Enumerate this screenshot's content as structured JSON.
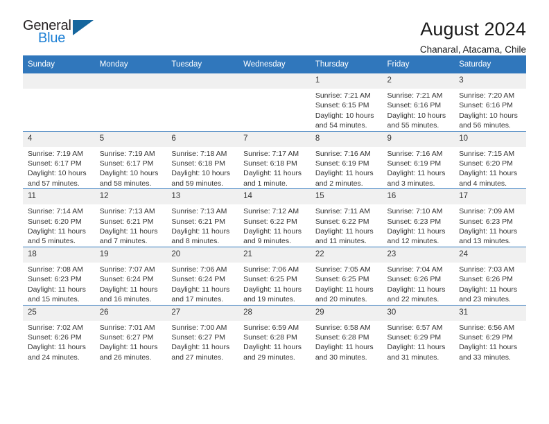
{
  "brand": {
    "name_top": "General",
    "name_bottom": "Blue",
    "triangle_color": "#15669e",
    "blue_color": "#1c7fd4"
  },
  "header": {
    "title": "August 2024",
    "subtitle": "Chanaral, Atacama, Chile"
  },
  "theme": {
    "header_bar": "#3077bc",
    "day_strip": "#f0f0f0",
    "text": "#333333"
  },
  "weekday_headers": [
    "Sunday",
    "Monday",
    "Tuesday",
    "Wednesday",
    "Thursday",
    "Friday",
    "Saturday"
  ],
  "labels": {
    "sunrise": "Sunrise:",
    "sunset": "Sunset:",
    "daylight": "Daylight:"
  },
  "weeks": [
    [
      {
        "day": "",
        "blank": true
      },
      {
        "day": "",
        "blank": true
      },
      {
        "day": "",
        "blank": true
      },
      {
        "day": "",
        "blank": true
      },
      {
        "day": "1",
        "sunrise": "Sunrise: 7:21 AM",
        "sunset": "Sunset: 6:15 PM",
        "daylight": "Daylight: 10 hours and 54 minutes."
      },
      {
        "day": "2",
        "sunrise": "Sunrise: 7:21 AM",
        "sunset": "Sunset: 6:16 PM",
        "daylight": "Daylight: 10 hours and 55 minutes."
      },
      {
        "day": "3",
        "sunrise": "Sunrise: 7:20 AM",
        "sunset": "Sunset: 6:16 PM",
        "daylight": "Daylight: 10 hours and 56 minutes."
      }
    ],
    [
      {
        "day": "4",
        "sunrise": "Sunrise: 7:19 AM",
        "sunset": "Sunset: 6:17 PM",
        "daylight": "Daylight: 10 hours and 57 minutes."
      },
      {
        "day": "5",
        "sunrise": "Sunrise: 7:19 AM",
        "sunset": "Sunset: 6:17 PM",
        "daylight": "Daylight: 10 hours and 58 minutes."
      },
      {
        "day": "6",
        "sunrise": "Sunrise: 7:18 AM",
        "sunset": "Sunset: 6:18 PM",
        "daylight": "Daylight: 10 hours and 59 minutes."
      },
      {
        "day": "7",
        "sunrise": "Sunrise: 7:17 AM",
        "sunset": "Sunset: 6:18 PM",
        "daylight": "Daylight: 11 hours and 1 minute."
      },
      {
        "day": "8",
        "sunrise": "Sunrise: 7:16 AM",
        "sunset": "Sunset: 6:19 PM",
        "daylight": "Daylight: 11 hours and 2 minutes."
      },
      {
        "day": "9",
        "sunrise": "Sunrise: 7:16 AM",
        "sunset": "Sunset: 6:19 PM",
        "daylight": "Daylight: 11 hours and 3 minutes."
      },
      {
        "day": "10",
        "sunrise": "Sunrise: 7:15 AM",
        "sunset": "Sunset: 6:20 PM",
        "daylight": "Daylight: 11 hours and 4 minutes."
      }
    ],
    [
      {
        "day": "11",
        "sunrise": "Sunrise: 7:14 AM",
        "sunset": "Sunset: 6:20 PM",
        "daylight": "Daylight: 11 hours and 5 minutes."
      },
      {
        "day": "12",
        "sunrise": "Sunrise: 7:13 AM",
        "sunset": "Sunset: 6:21 PM",
        "daylight": "Daylight: 11 hours and 7 minutes."
      },
      {
        "day": "13",
        "sunrise": "Sunrise: 7:13 AM",
        "sunset": "Sunset: 6:21 PM",
        "daylight": "Daylight: 11 hours and 8 minutes."
      },
      {
        "day": "14",
        "sunrise": "Sunrise: 7:12 AM",
        "sunset": "Sunset: 6:22 PM",
        "daylight": "Daylight: 11 hours and 9 minutes."
      },
      {
        "day": "15",
        "sunrise": "Sunrise: 7:11 AM",
        "sunset": "Sunset: 6:22 PM",
        "daylight": "Daylight: 11 hours and 11 minutes."
      },
      {
        "day": "16",
        "sunrise": "Sunrise: 7:10 AM",
        "sunset": "Sunset: 6:23 PM",
        "daylight": "Daylight: 11 hours and 12 minutes."
      },
      {
        "day": "17",
        "sunrise": "Sunrise: 7:09 AM",
        "sunset": "Sunset: 6:23 PM",
        "daylight": "Daylight: 11 hours and 13 minutes."
      }
    ],
    [
      {
        "day": "18",
        "sunrise": "Sunrise: 7:08 AM",
        "sunset": "Sunset: 6:23 PM",
        "daylight": "Daylight: 11 hours and 15 minutes."
      },
      {
        "day": "19",
        "sunrise": "Sunrise: 7:07 AM",
        "sunset": "Sunset: 6:24 PM",
        "daylight": "Daylight: 11 hours and 16 minutes."
      },
      {
        "day": "20",
        "sunrise": "Sunrise: 7:06 AM",
        "sunset": "Sunset: 6:24 PM",
        "daylight": "Daylight: 11 hours and 17 minutes."
      },
      {
        "day": "21",
        "sunrise": "Sunrise: 7:06 AM",
        "sunset": "Sunset: 6:25 PM",
        "daylight": "Daylight: 11 hours and 19 minutes."
      },
      {
        "day": "22",
        "sunrise": "Sunrise: 7:05 AM",
        "sunset": "Sunset: 6:25 PM",
        "daylight": "Daylight: 11 hours and 20 minutes."
      },
      {
        "day": "23",
        "sunrise": "Sunrise: 7:04 AM",
        "sunset": "Sunset: 6:26 PM",
        "daylight": "Daylight: 11 hours and 22 minutes."
      },
      {
        "day": "24",
        "sunrise": "Sunrise: 7:03 AM",
        "sunset": "Sunset: 6:26 PM",
        "daylight": "Daylight: 11 hours and 23 minutes."
      }
    ],
    [
      {
        "day": "25",
        "sunrise": "Sunrise: 7:02 AM",
        "sunset": "Sunset: 6:26 PM",
        "daylight": "Daylight: 11 hours and 24 minutes."
      },
      {
        "day": "26",
        "sunrise": "Sunrise: 7:01 AM",
        "sunset": "Sunset: 6:27 PM",
        "daylight": "Daylight: 11 hours and 26 minutes."
      },
      {
        "day": "27",
        "sunrise": "Sunrise: 7:00 AM",
        "sunset": "Sunset: 6:27 PM",
        "daylight": "Daylight: 11 hours and 27 minutes."
      },
      {
        "day": "28",
        "sunrise": "Sunrise: 6:59 AM",
        "sunset": "Sunset: 6:28 PM",
        "daylight": "Daylight: 11 hours and 29 minutes."
      },
      {
        "day": "29",
        "sunrise": "Sunrise: 6:58 AM",
        "sunset": "Sunset: 6:28 PM",
        "daylight": "Daylight: 11 hours and 30 minutes."
      },
      {
        "day": "30",
        "sunrise": "Sunrise: 6:57 AM",
        "sunset": "Sunset: 6:29 PM",
        "daylight": "Daylight: 11 hours and 31 minutes."
      },
      {
        "day": "31",
        "sunrise": "Sunrise: 6:56 AM",
        "sunset": "Sunset: 6:29 PM",
        "daylight": "Daylight: 11 hours and 33 minutes."
      }
    ]
  ]
}
